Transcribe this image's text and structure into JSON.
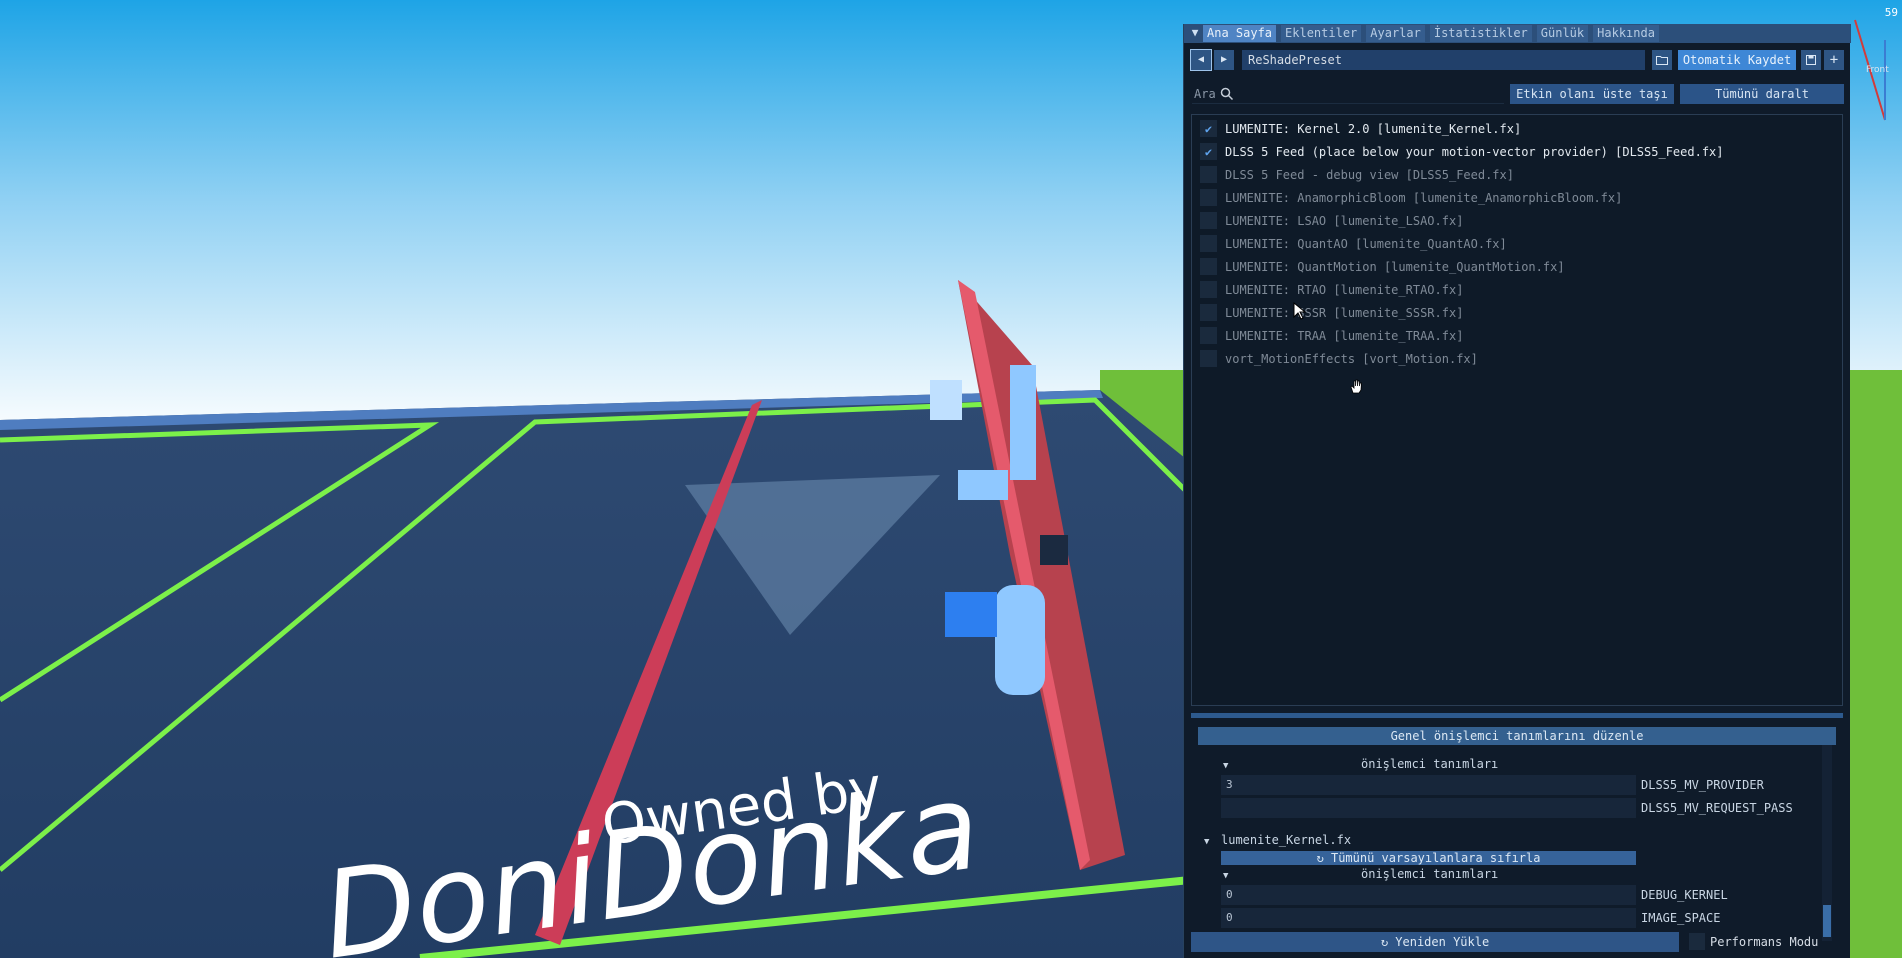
{
  "fps": "59",
  "scene": {
    "watermark_line1": "Owned by",
    "watermark_line2": "DoniDonka",
    "axis_label": "Front"
  },
  "tabs": [
    "Ana Sayfa",
    "Eklentiler",
    "Ayarlar",
    "İstatistikler",
    "Günlük",
    "Hakkında"
  ],
  "toolbar": {
    "preset_name": "ReShadePreset",
    "autosave_label": "Otomatik Kaydet"
  },
  "search": {
    "label": "Ara",
    "placeholder": "",
    "move_active_label": "Etkin olanı üste taşı",
    "collapse_all_label": "Tümünü daralt"
  },
  "effects": [
    {
      "label": "LUMENITE: Kernel 2.0 [lumenite_Kernel.fx]",
      "enabled": true
    },
    {
      "label": "DLSS 5 Feed (place below your motion-vector provider) [DLSS5_Feed.fx]",
      "enabled": true
    },
    {
      "label": "DLSS 5 Feed - debug view [DLSS5_Feed.fx]",
      "enabled": false
    },
    {
      "label": "LUMENITE: AnamorphicBloom [lumenite_AnamorphicBloom.fx]",
      "enabled": false
    },
    {
      "label": "LUMENITE: LSAO [lumenite_LSAO.fx]",
      "enabled": false
    },
    {
      "label": "LUMENITE: QuantAO [lumenite_QuantAO.fx]",
      "enabled": false
    },
    {
      "label": "LUMENITE: QuantMotion [lumenite_QuantMotion.fx]",
      "enabled": false
    },
    {
      "label": "LUMENITE: RTAO [lumenite_RTAO.fx]",
      "enabled": false
    },
    {
      "label": "LUMENITE: SSSR [lumenite_SSSR.fx]",
      "enabled": false
    },
    {
      "label": "LUMENITE: TRAA [lumenite_TRAA.fx]",
      "enabled": false
    },
    {
      "label": "vort_MotionEffects [vort_Motion.fx]",
      "enabled": false
    }
  ],
  "preprocessor": {
    "header": "Genel önişlemci tanımlarını düzenle",
    "group1_label": "önişlemci tanımları",
    "group1_defs": [
      {
        "value": "3",
        "name": "DLSS5_MV_PROVIDER"
      },
      {
        "value": "",
        "name": "DLSS5_MV_REQUEST_PASS"
      }
    ],
    "file_label": "lumenite_Kernel.fx",
    "reset_label": "Tümünü varsayılanlara sıfırla",
    "group2_label": "önişlemci tanımları",
    "group2_defs": [
      {
        "value": "0",
        "name": "DEBUG_KERNEL"
      },
      {
        "value": "0",
        "name": "IMAGE_SPACE"
      }
    ]
  },
  "bottom": {
    "reload_label": "Yeniden Yükle",
    "performance_label": "Performans Modu"
  },
  "colors": {
    "panel_bg": "#0f1b2a",
    "accent": "#3e87d6",
    "tab_bar": "#2c4f7a",
    "check": "#5fa4ee"
  }
}
